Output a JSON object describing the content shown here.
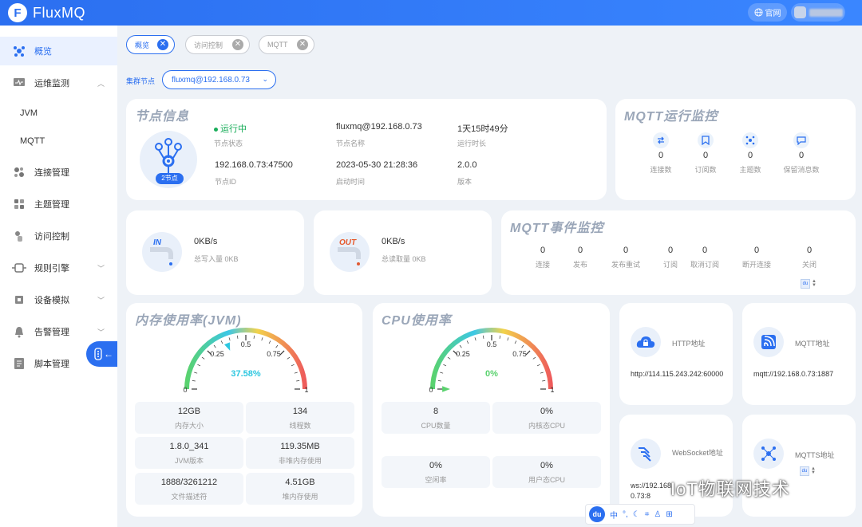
{
  "app": {
    "logo_letter": "F",
    "title": "FluxMQ",
    "site_button": "官网"
  },
  "colors": {
    "primary": "#2b6ff0",
    "running": "#1aad5a",
    "gauge_value": "#2ec7e0",
    "sidebar_active_bg": "#eaf1ff"
  },
  "sidebar": {
    "items": [
      {
        "label": "概览",
        "icon": "overview-icon"
      },
      {
        "label": "运维监测",
        "icon": "monitor-icon",
        "chevron": "︿"
      },
      {
        "label": "JVM"
      },
      {
        "label": "MQTT"
      },
      {
        "label": "连接管理",
        "icon": "connection-icon"
      },
      {
        "label": "主题管理",
        "icon": "topic-icon"
      },
      {
        "label": "访问控制",
        "icon": "access-icon"
      },
      {
        "label": "规则引擎",
        "icon": "rule-icon",
        "chevron": "﹀"
      },
      {
        "label": "设备模拟",
        "icon": "device-icon",
        "chevron": "﹀"
      },
      {
        "label": "告警管理",
        "icon": "alarm-icon",
        "chevron": "﹀"
      },
      {
        "label": "脚本管理",
        "icon": "script-icon"
      }
    ],
    "toggle_arrow": "←"
  },
  "tabs": [
    {
      "label": "概览",
      "close": "✕"
    },
    {
      "label": "访问控制",
      "close": "✕"
    },
    {
      "label": "MQTT",
      "close": "✕"
    }
  ],
  "cluster": {
    "label": "集群节点",
    "value": "fluxmq@192.168.0.73",
    "chevron": "⌄"
  },
  "node_info": {
    "title": "节点信息",
    "badge": "2节点",
    "status_value": "运行中",
    "status_label": "节点状态",
    "name_value": "fluxmq@192.168.0.73",
    "name_label": "节点名称",
    "uptime_value": "1天15时49分",
    "uptime_label": "运行时长",
    "id_value": "192.168.0.73:47500",
    "id_label": "节点ID",
    "start_value": "2023-05-30 21:28:36",
    "start_label": "启动时间",
    "version_value": "2.0.0",
    "version_label": "版本"
  },
  "mqtt_monitor": {
    "title": "MQTT运行监控",
    "items": [
      {
        "value": "0",
        "label": "连接数"
      },
      {
        "value": "0",
        "label": "订阅数"
      },
      {
        "value": "0",
        "label": "主题数"
      },
      {
        "value": "0",
        "label": "保留消息数"
      }
    ]
  },
  "traffic_in": {
    "badge": "IN",
    "value": "0KB/s",
    "label": "总写入量 0KB"
  },
  "traffic_out": {
    "badge": "OUT",
    "value": "0KB/s",
    "label": "总读取量 0KB"
  },
  "mqtt_events": {
    "title": "MQTT事件监控",
    "items": [
      {
        "value": "0",
        "label": "连接"
      },
      {
        "value": "0",
        "label": "发布"
      },
      {
        "value": "0",
        "label": "发布重试"
      },
      {
        "value": "0",
        "label": "订阅"
      },
      {
        "value": "0",
        "label": "取消订阅"
      },
      {
        "value": "0",
        "label": "断开连接"
      },
      {
        "value": "0",
        "label": "关闭"
      }
    ],
    "control": "du"
  },
  "memory": {
    "title": "内存使用率(JVM)",
    "gauge": {
      "value_text": "37.58%",
      "fraction": 0.3758,
      "ticks": [
        "0",
        "0.25",
        "0.5",
        "0.75",
        "1"
      ]
    },
    "stats": [
      {
        "value": "12GB",
        "label": "内存大小"
      },
      {
        "value": "134",
        "label": "线程数"
      },
      {
        "value": "1.8.0_341",
        "label": "JVM版本"
      },
      {
        "value": "119.35MB",
        "label": "非堆内存使用"
      },
      {
        "value": "1888/3261212",
        "label": "文件描述符"
      },
      {
        "value": "4.51GB",
        "label": "堆内存使用"
      }
    ]
  },
  "cpu": {
    "title": "CPU使用率",
    "gauge": {
      "value_text": "0%",
      "fraction": 0,
      "ticks": [
        "0",
        "0.25",
        "0.5",
        "0.75",
        "1"
      ]
    },
    "stats": [
      {
        "value": "8",
        "label": "CPU数量"
      },
      {
        "value": "0%",
        "label": "内核态CPU"
      },
      {
        "value": "0%",
        "label": "空闲率"
      },
      {
        "value": "0%",
        "label": "用户态CPU"
      }
    ]
  },
  "addresses": {
    "http": {
      "title": "HTTP地址",
      "value": "http://114.115.243.242:60000"
    },
    "mqtt": {
      "title": "MQTT地址",
      "value": "mqtt://192.168.0.73:1887"
    },
    "websocket": {
      "title": "WebSocket地址",
      "value": "ws://192.168.0.73:8"
    },
    "mqtts": {
      "title": "MQTTS地址",
      "control": "du"
    }
  },
  "toolbar": {
    "logo": "du",
    "items": [
      "中",
      "°,",
      "☾",
      "⌗",
      "♙",
      "⊞"
    ]
  },
  "watermark": "IoT物联网技术"
}
